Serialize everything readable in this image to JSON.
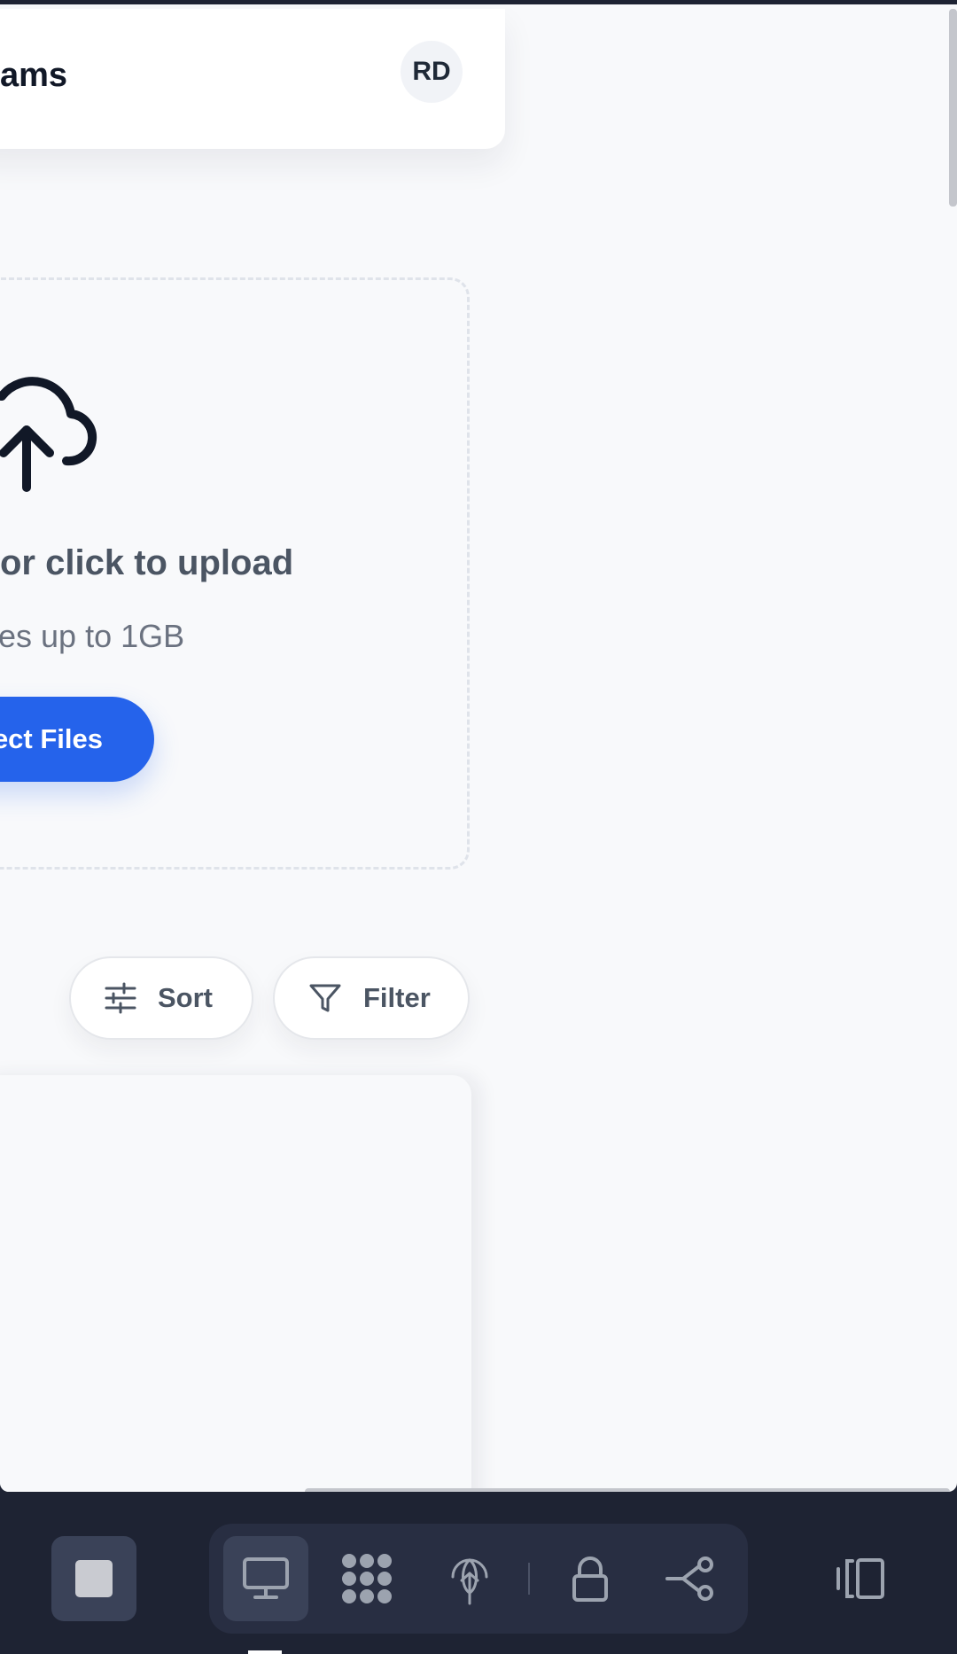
{
  "header": {
    "title": "ams",
    "avatar_initials": "RD"
  },
  "upload": {
    "title": "or click to upload",
    "subtitle": "es up to 1GB",
    "select_button": "ect Files",
    "icon": "cloud-upload-icon"
  },
  "toolbar": {
    "sort_label": "Sort",
    "filter_label": "Filter",
    "sort_icon": "sliders-icon",
    "filter_icon": "funnel-icon"
  },
  "dock": {
    "tools": [
      "monitor-icon",
      "dots-grid-icon",
      "network-globe-icon",
      "lock-icon",
      "share-icon"
    ],
    "active_tool": "monitor-icon"
  },
  "colors": {
    "accent": "#2563eb",
    "dock_background": "#1e2333",
    "page_background": "#f8f9fb"
  }
}
